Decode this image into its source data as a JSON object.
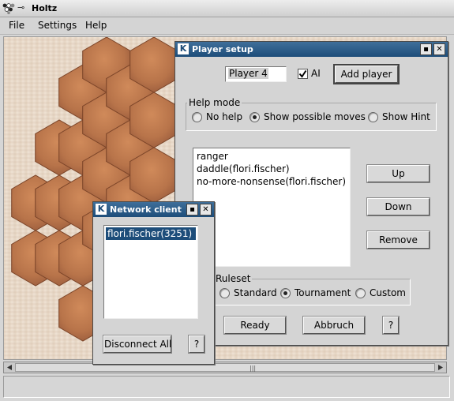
{
  "window": {
    "title": "Holtz"
  },
  "menu": [
    "File",
    "Settings",
    "Help"
  ],
  "colors": {
    "title_bar": "#1d4d7a",
    "selection": "#1d4d7a",
    "hex_tile": "#b8744a"
  },
  "player_setup": {
    "title": "Player setup",
    "player_name_value": "Player 4",
    "ai_label": "AI",
    "ai_checked": true,
    "add_player_label": "Add player",
    "help_mode": {
      "label": "Help mode",
      "options": [
        "No help",
        "Show possible moves",
        "Show Hint"
      ],
      "selected": "Show possible moves"
    },
    "players": [
      "ranger",
      "daddle(flori.fischer)",
      "no-more-nonsense(flori.fischer)"
    ],
    "up_label": "Up",
    "down_label": "Down",
    "remove_label": "Remove",
    "ruleset": {
      "label": "Ruleset",
      "options": [
        "Standard",
        "Tournament",
        "Custom"
      ],
      "selected": "Tournament"
    },
    "ready_label": "Ready",
    "abbruch_label": "Abbruch",
    "help_button_label": "?"
  },
  "network_setup": {
    "title": "Network client setup",
    "clients": [
      "flori.fischer(3251)"
    ],
    "disconnect_label": "Disconnect All",
    "help_button_label": "?"
  }
}
